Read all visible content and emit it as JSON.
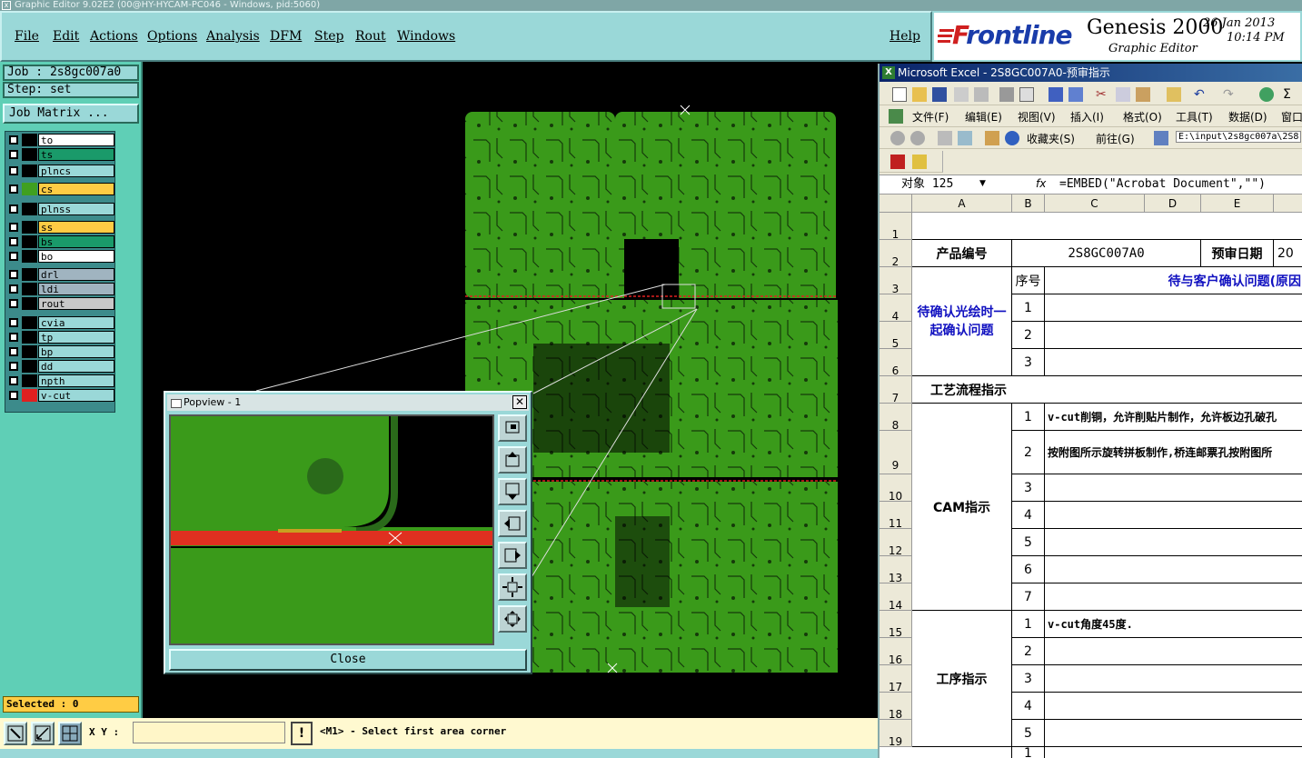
{
  "titlebar": {
    "text": "Graphic Editor 9.02E2 (00@HY-HYCAM-PC046 - Windows, pid:5060)"
  },
  "menu": {
    "file": "File",
    "edit": "Edit",
    "actions": "Actions",
    "options": "Options",
    "analysis": "Analysis",
    "dfm": "DFM",
    "step": "Step",
    "rout": "Rout",
    "windows": "Windows",
    "help": "Help"
  },
  "brand": {
    "logo_f": "F",
    "logo_rest": "rontline",
    "product": "Genesis 2000",
    "subtitle": "Graphic Editor",
    "date": "26 Jan 2013",
    "time": "10:14 PM"
  },
  "left": {
    "job": "Job : 2s8gc007a0",
    "step": "Step: set",
    "job_matrix": "Job Matrix ...",
    "layers": [
      {
        "name": "to",
        "color": "#ffffff",
        "swatch": "#000000"
      },
      {
        "name": "ts",
        "color": "#1a9a6a",
        "swatch": "#000000"
      },
      {
        "name": "plncs",
        "color": "#9ad8d8",
        "swatch": "#000000"
      },
      {
        "name": "cs",
        "color": "#ffcc44",
        "swatch": "#40a020"
      },
      {
        "name": "plnss",
        "color": "#9ad8d8",
        "swatch": "#000000"
      },
      {
        "name": "ss",
        "color": "#ffcc44",
        "swatch": "#000000"
      },
      {
        "name": "bs",
        "color": "#1a9a6a",
        "swatch": "#000000"
      },
      {
        "name": "bo",
        "color": "#ffffff",
        "swatch": "#000000"
      },
      {
        "name": "drl",
        "color": "#a0b4c0",
        "swatch": "#000000"
      },
      {
        "name": "ldi",
        "color": "#a0b4c0",
        "swatch": "#000000"
      },
      {
        "name": "rout",
        "color": "#c8c8c8",
        "swatch": "#000000"
      },
      {
        "name": "cvia",
        "color": "#9ad8d8",
        "swatch": "#000000"
      },
      {
        "name": "tp",
        "color": "#9ad8d8",
        "swatch": "#000000"
      },
      {
        "name": "bp",
        "color": "#9ad8d8",
        "swatch": "#000000"
      },
      {
        "name": "dd",
        "color": "#9ad8d8",
        "swatch": "#000000"
      },
      {
        "name": "npth",
        "color": "#9ad8d8",
        "swatch": "#000000"
      },
      {
        "name": "v-cut",
        "color": "#9ad8d8",
        "swatch": "#e02020"
      }
    ],
    "selected": "Selected : 0"
  },
  "bottom": {
    "xy_label": "X Y :",
    "xy_value": "",
    "warn": "!",
    "status": "<M1> - Select first area corner"
  },
  "popview": {
    "title": "Popview - 1",
    "close": "Close",
    "close_x": "✕"
  },
  "excel": {
    "title": "Microsoft Excel - 2S8GC007A0-预审指示",
    "menus": [
      "文件(F)",
      "编辑(E)",
      "视图(V)",
      "插入(I)",
      "格式(O)",
      "工具(T)",
      "数据(D)",
      "窗口"
    ],
    "favorites": "收藏夹(S)",
    "goto": "前往(G)",
    "address": "E:\\input\\2s8gc007a\\2S8",
    "namebox": "对象 125",
    "fx": "fx",
    "formula": "=EMBED(\"Acrobat Document\",\"\")",
    "cols": [
      "A",
      "B",
      "C",
      "D",
      "E"
    ],
    "rows": [
      "1",
      "2",
      "3",
      "4",
      "5",
      "6",
      "7",
      "8",
      "9",
      "10",
      "11",
      "12",
      "13",
      "14",
      "15",
      "16",
      "17",
      "18",
      "19"
    ],
    "r2_label": "产品编号",
    "r2_value": "2S8GC007A0",
    "r2_date": "预审日期",
    "r2_year": "20",
    "r3_seq": "序号",
    "r3_header": "待与客户确认问题(原因",
    "confirm_label": "待确认光绘时一起确认问题",
    "process_label": "工艺流程指示",
    "cam_label": "CAM指示",
    "proc_label": "工序指示",
    "r8_text": "v-cut削铜，允许削贴片制作，允许板边孔破孔",
    "r9_text": "按附图所示旋转拼板制作,桥连邮票孔按附图所",
    "r15_text": "v-cut角度45度.",
    "nums": [
      "1",
      "2",
      "3",
      "1",
      "2",
      "3",
      "4",
      "5",
      "6",
      "7",
      "1",
      "2",
      "3",
      "4",
      "5",
      "1"
    ]
  }
}
